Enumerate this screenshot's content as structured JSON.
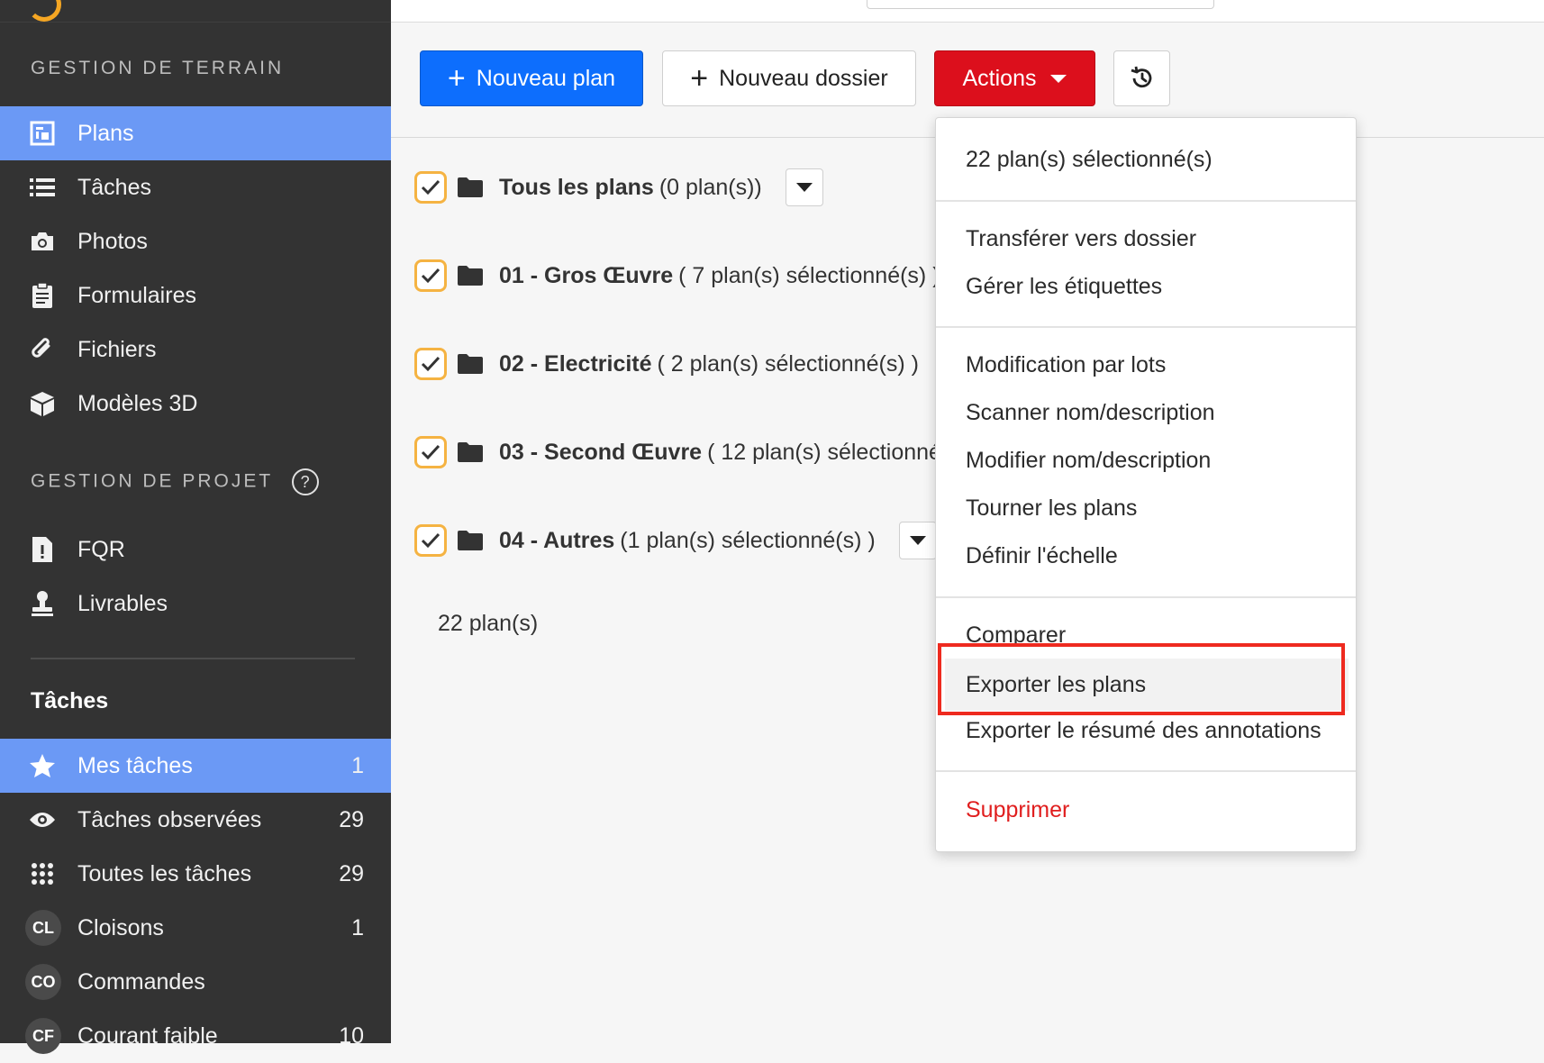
{
  "sidebar": {
    "section_field": "GESTION DE TERRAIN",
    "field_items": [
      {
        "label": "Plans",
        "icon": "plans-icon"
      },
      {
        "label": "Tâches",
        "icon": "list-icon"
      },
      {
        "label": "Photos",
        "icon": "camera-icon"
      },
      {
        "label": "Formulaires",
        "icon": "clipboard-icon"
      },
      {
        "label": "Fichiers",
        "icon": "paperclip-icon"
      },
      {
        "label": "Modèles 3D",
        "icon": "cube-icon"
      }
    ],
    "section_project": "GESTION DE PROJET",
    "project_items": [
      {
        "label": "FQR",
        "icon": "file-alert-icon"
      },
      {
        "label": "Livrables",
        "icon": "stamp-icon"
      }
    ],
    "tasks_heading": "Tâches",
    "task_items": [
      {
        "label": "Mes tâches",
        "count": "1",
        "icon": "star-icon"
      },
      {
        "label": "Tâches observées",
        "count": "29",
        "icon": "eye-icon"
      },
      {
        "label": "Toutes les tâches",
        "count": "29",
        "icon": "grid-icon"
      },
      {
        "label": "Cloisons",
        "count": "1",
        "badge": "CL"
      },
      {
        "label": "Commandes",
        "count": "",
        "badge": "CO"
      },
      {
        "label": "Courant faible",
        "count": "10",
        "badge": "CF"
      }
    ]
  },
  "toolbar": {
    "new_plan": "Nouveau plan",
    "new_folder": "Nouveau dossier",
    "actions": "Actions"
  },
  "folders": [
    {
      "name": "Tous les plans",
      "detail": "(0 plan(s))"
    },
    {
      "name": "01 - Gros Œuvre",
      "detail": "( 7 plan(s) sélectionné(s) )"
    },
    {
      "name": "02 - Electricité",
      "detail": "( 2 plan(s) sélectionné(s) )"
    },
    {
      "name": "03 - Second Œuvre",
      "detail": "( 12 plan(s) sélectionné"
    },
    {
      "name": "04 - Autres",
      "detail": "(1 plan(s) sélectionné(s) )"
    }
  ],
  "plan_total": "22 plan(s)",
  "menu": {
    "header": "22 plan(s) sélectionné(s)",
    "transfer": "Transférer vers dossier",
    "tags": "Gérer les étiquettes",
    "batch_edit": "Modification par lots",
    "scan": "Scanner nom/description",
    "edit_name": "Modifier nom/description",
    "rotate": "Tourner les plans",
    "scale": "Définir l'échelle",
    "compare": "Comparer",
    "export_plans": "Exporter les plans",
    "export_summary": "Exporter le résumé des annotations",
    "delete": "Supprimer"
  },
  "colors": {
    "sidebar_bg": "#333333",
    "active_item": "#6b99f5",
    "primary": "#0d6efd",
    "danger": "#dc0f1c",
    "checkbox_border": "#f5b342",
    "highlight_outline": "#ee2a1f"
  }
}
